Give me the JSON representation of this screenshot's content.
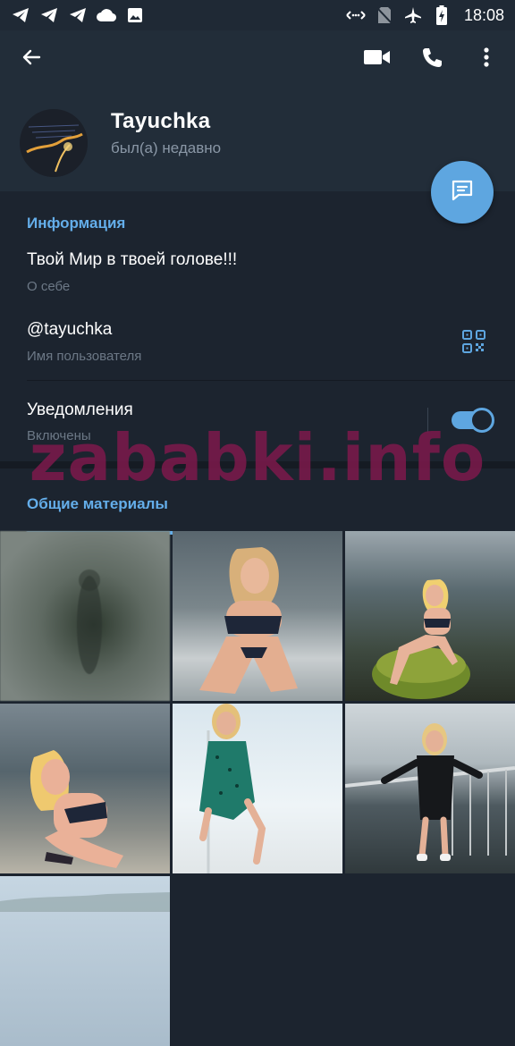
{
  "status_bar": {
    "time": "18:08",
    "left_icons": [
      "telegram-icon",
      "telegram-icon",
      "telegram-icon",
      "cloud-icon",
      "image-icon"
    ],
    "right_icons": [
      "data-saver-icon",
      "no-sim-icon",
      "airplane-icon",
      "battery-charging-icon"
    ]
  },
  "header": {
    "name": "Tayuchka",
    "status": "был(а) недавно",
    "icons": [
      "back-arrow-icon",
      "video-camera-icon",
      "phone-icon",
      "more-vert-icon"
    ]
  },
  "info": {
    "section_title": "Информация",
    "bio_value": "Твой Мир в твоей голове!!!",
    "bio_caption": "О себе",
    "username_value": "@tayuchka",
    "username_caption": "Имя пользователя",
    "notifications_value": "Уведомления",
    "notifications_caption": "Включены",
    "notifications_enabled": true
  },
  "watermark": "zababki.info",
  "media": {
    "tab_label": "Общие материалы",
    "tile_count_visible": 7
  },
  "colors": {
    "background": "#1c242f",
    "header": "#222d39",
    "accent": "#64aeea",
    "fab": "#5ea6e0",
    "secondary_text": "#6c7886",
    "watermark": "#7d194b"
  }
}
